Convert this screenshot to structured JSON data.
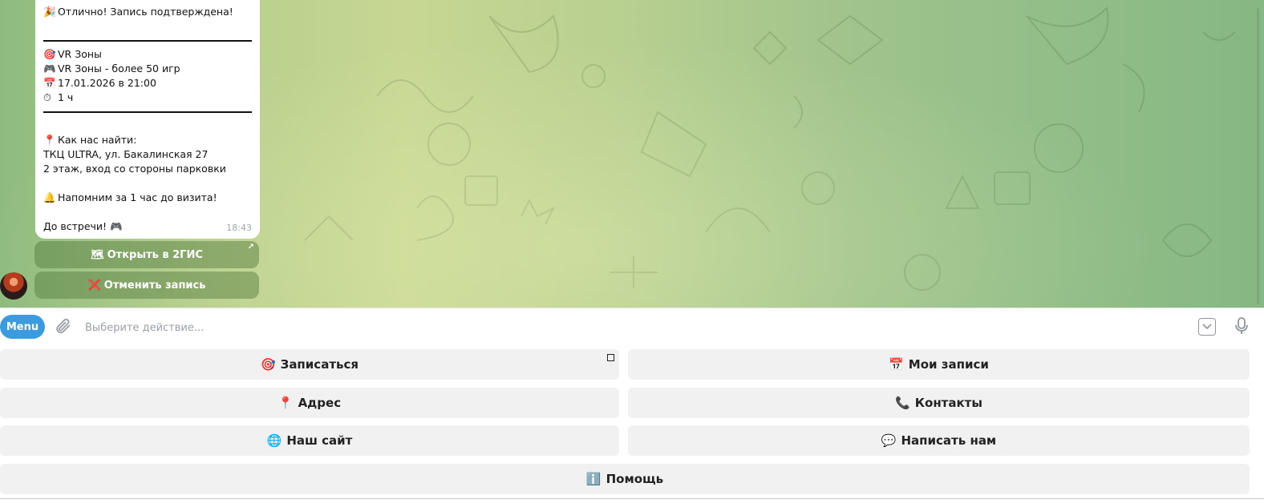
{
  "message": {
    "header_emoji": "🎉",
    "header_text": "Отлично! Запись подтверждена!",
    "details": [
      {
        "icon": "🎯",
        "text": "VR Зоны"
      },
      {
        "icon": "🎮",
        "text": "VR Зоны - более 50 игр"
      },
      {
        "icon": "📅",
        "text": "17.01.2026 в 21:00"
      },
      {
        "icon": "⏱",
        "text": "1 ч"
      }
    ],
    "location_icon": "📍",
    "location_title": "Как нас найти:",
    "address_line1": "ТКЦ ULTRA, ул. Бакалинская 27",
    "address_line2": "2 этаж, вход со стороны парковки",
    "reminder_icon": "🔔",
    "reminder_text": "Напомним за 1 час до визита!",
    "farewell_text": "До встречи!",
    "farewell_icon": "🎮",
    "time": "18:43"
  },
  "inline_buttons": {
    "open_2gis": {
      "icon": "🗺",
      "label": "Открыть в 2ГИС",
      "ext_icon": "↗"
    },
    "cancel": {
      "icon": "❌",
      "label": "Отменить запись"
    }
  },
  "input_bar": {
    "menu_label": "Menu",
    "placeholder": "Выберите действие..."
  },
  "keyboard": {
    "signup": {
      "icon": "🎯",
      "label": "Записаться"
    },
    "my_bookings": {
      "icon": "📅",
      "label": "Мои записи"
    },
    "address": {
      "icon": "📍",
      "label": "Адрес"
    },
    "contacts": {
      "icon": "📞",
      "label": "Контакты"
    },
    "website": {
      "icon": "🌐",
      "label": "Наш сайт"
    },
    "write_us": {
      "icon": "💬",
      "label": "Написать нам"
    },
    "help": {
      "icon": "ℹ️",
      "label": "Помощь"
    }
  },
  "colors": {
    "menu_button": "#3a9be0",
    "keyboard_button": "#f1f1f1",
    "chat_background": "#b7cf90"
  }
}
